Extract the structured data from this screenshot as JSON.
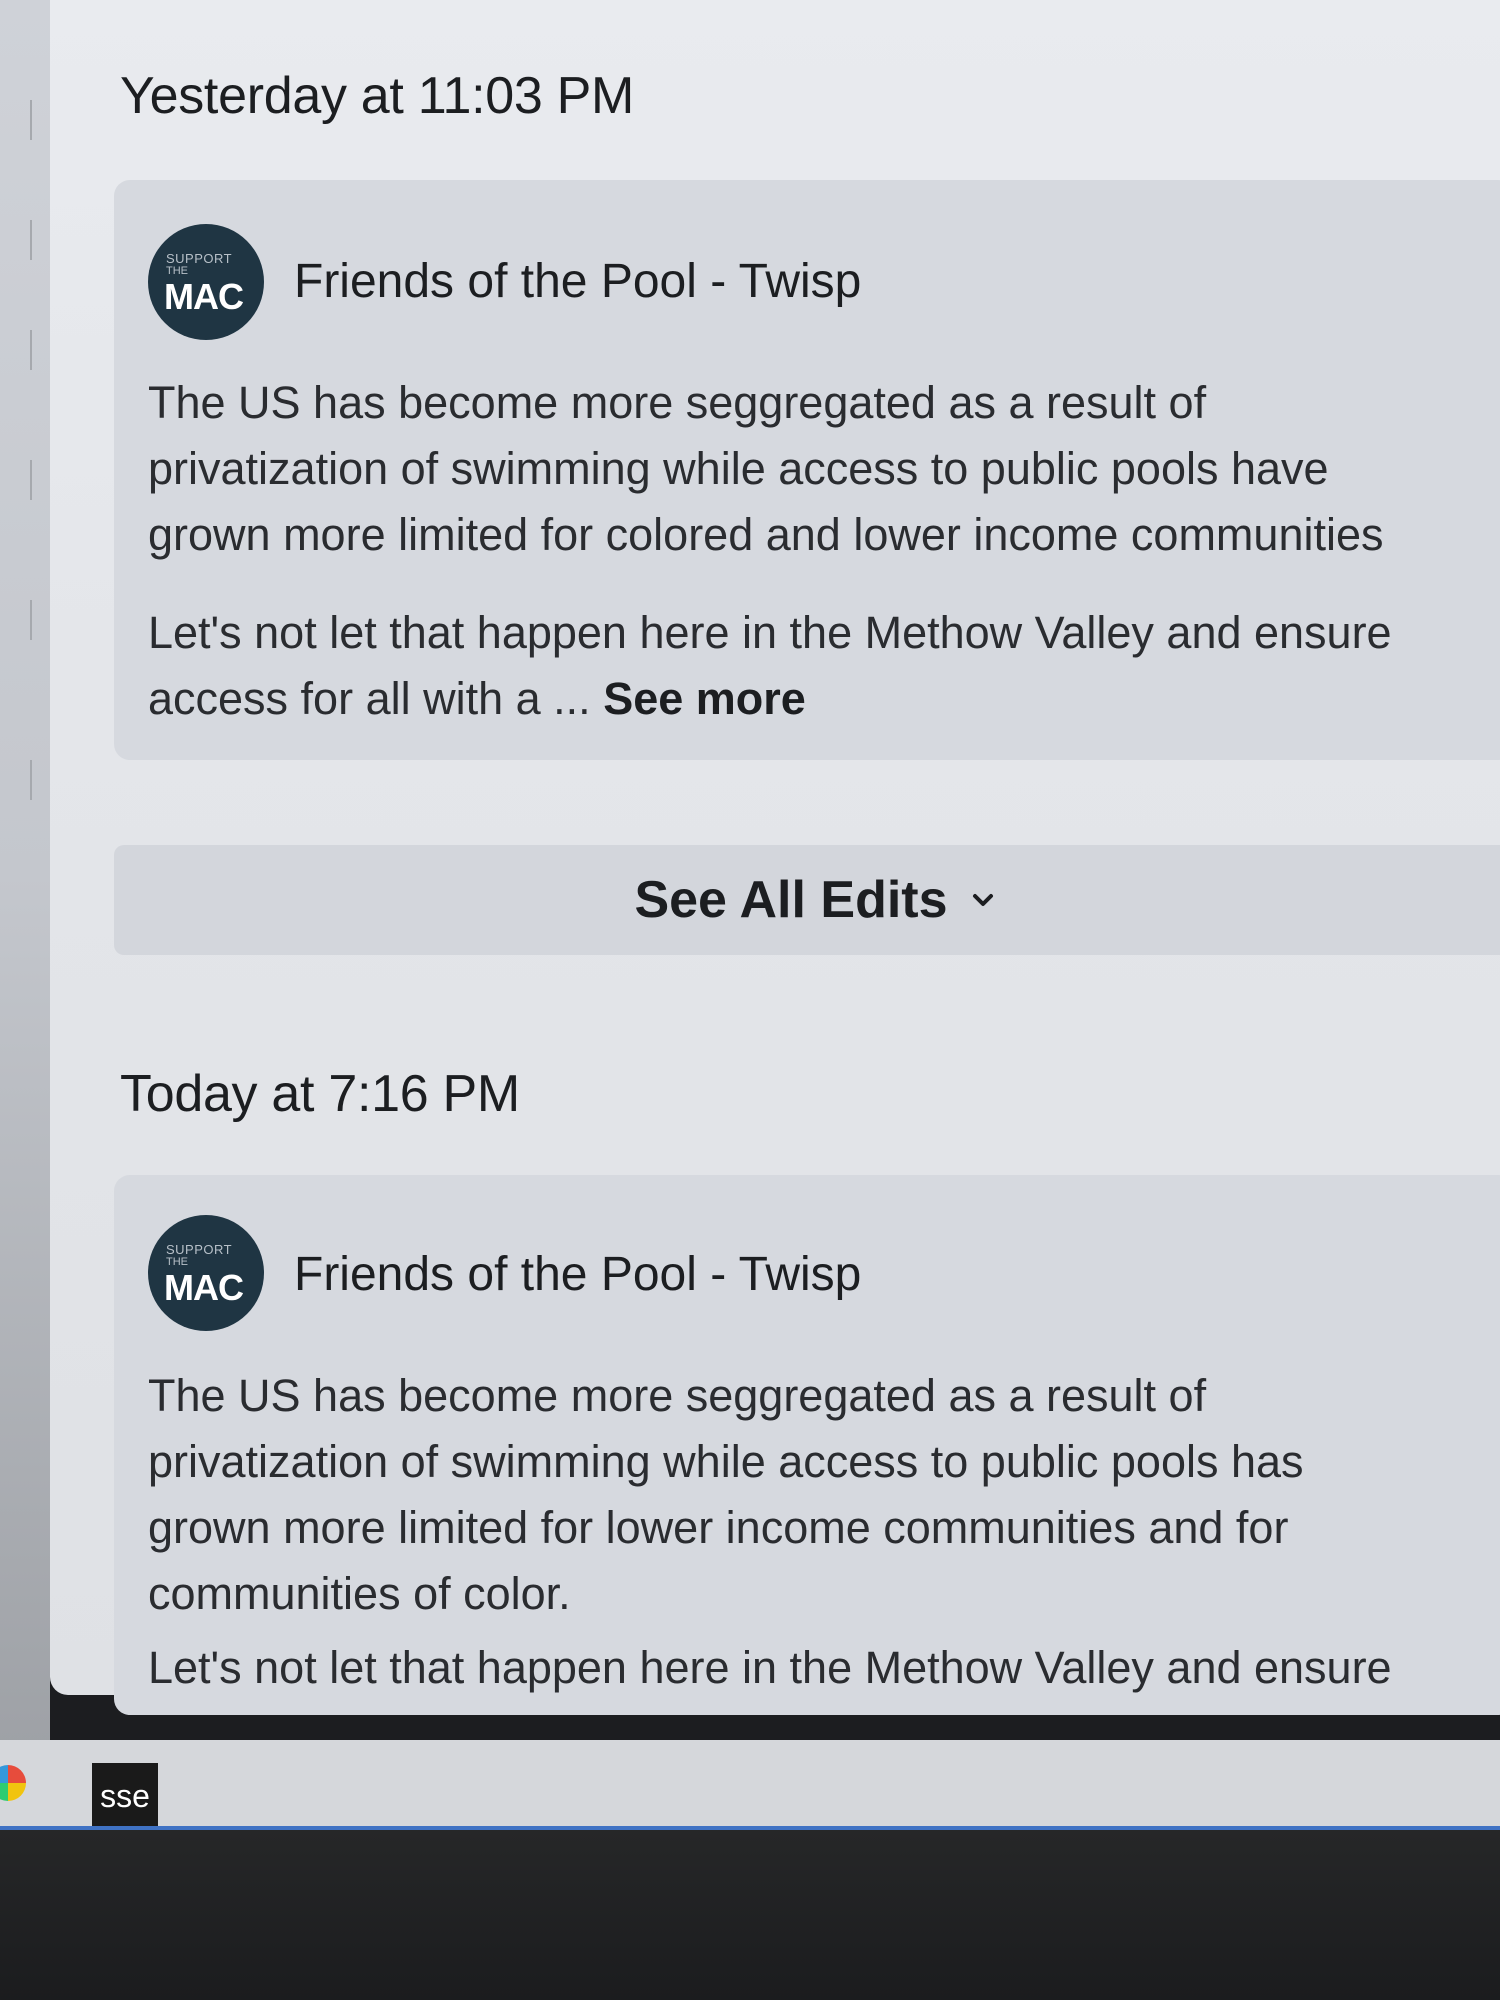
{
  "history": [
    {
      "timestamp": "Yesterday at 11:03 PM",
      "page_name": "Friends of the Pool - Twisp",
      "avatar": {
        "line1": "SUPPORT",
        "line2": "THE",
        "line3": "MAC"
      },
      "lines": [
        "The US has become more seggregated as a result of",
        "privatization of swimming while access to public pools have",
        "grown more limited for colored and lower income communities"
      ],
      "lines2": [
        "Let's not let that happen here in the Methow Valley and ensure",
        "access for all with a ..."
      ],
      "see_more": "See more"
    },
    {
      "timestamp": "Today at 7:16 PM",
      "page_name": "Friends of the Pool - Twisp",
      "avatar": {
        "line1": "SUPPORT",
        "line2": "THE",
        "line3": "MAC"
      },
      "lines": [
        "The US has become more seggregated as a result of",
        "privatization of swimming while access to public pools has",
        "grown more limited for lower income communities and for",
        "communities of color."
      ],
      "lines2": [
        "Let's not let that happen here in the Methow Valley and ensure"
      ]
    }
  ],
  "edits_button": {
    "label": "See All Edits",
    "icon": "chevron-down-icon"
  },
  "taskbar": {
    "app_label": "sse"
  },
  "colors": {
    "avatar_bg": "#1f3543",
    "card_bg": "#d6d9df",
    "panel_bg": "#e4e6ea"
  }
}
